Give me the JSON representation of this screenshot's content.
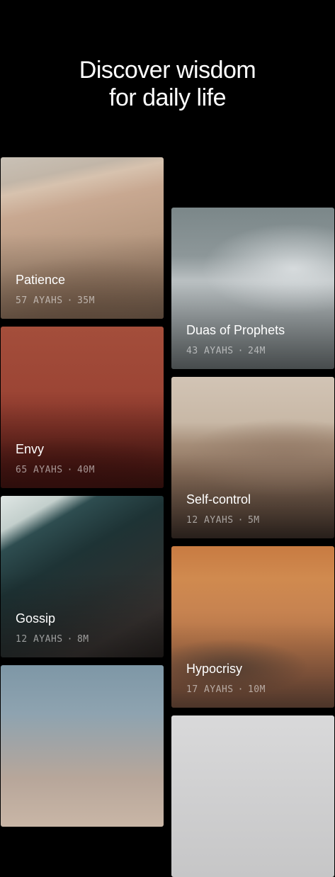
{
  "headline": {
    "line1": "Discover wisdom",
    "line2": "for daily life"
  },
  "separator": "·",
  "cards": [
    {
      "title": "Patience",
      "ayahs": "57 AYAHS",
      "duration": "35M"
    },
    {
      "title": "Duas of Prophets",
      "ayahs": "43 AYAHS",
      "duration": "24M"
    },
    {
      "title": "Envy",
      "ayahs": "65 AYAHS",
      "duration": "40M"
    },
    {
      "title": "Self-control",
      "ayahs": "12 AYAHS",
      "duration": "5M"
    },
    {
      "title": "Gossip",
      "ayahs": "12 AYAHS",
      "duration": "8M"
    },
    {
      "title": "Hypocrisy",
      "ayahs": "17 AYAHS",
      "duration": "10M"
    }
  ]
}
